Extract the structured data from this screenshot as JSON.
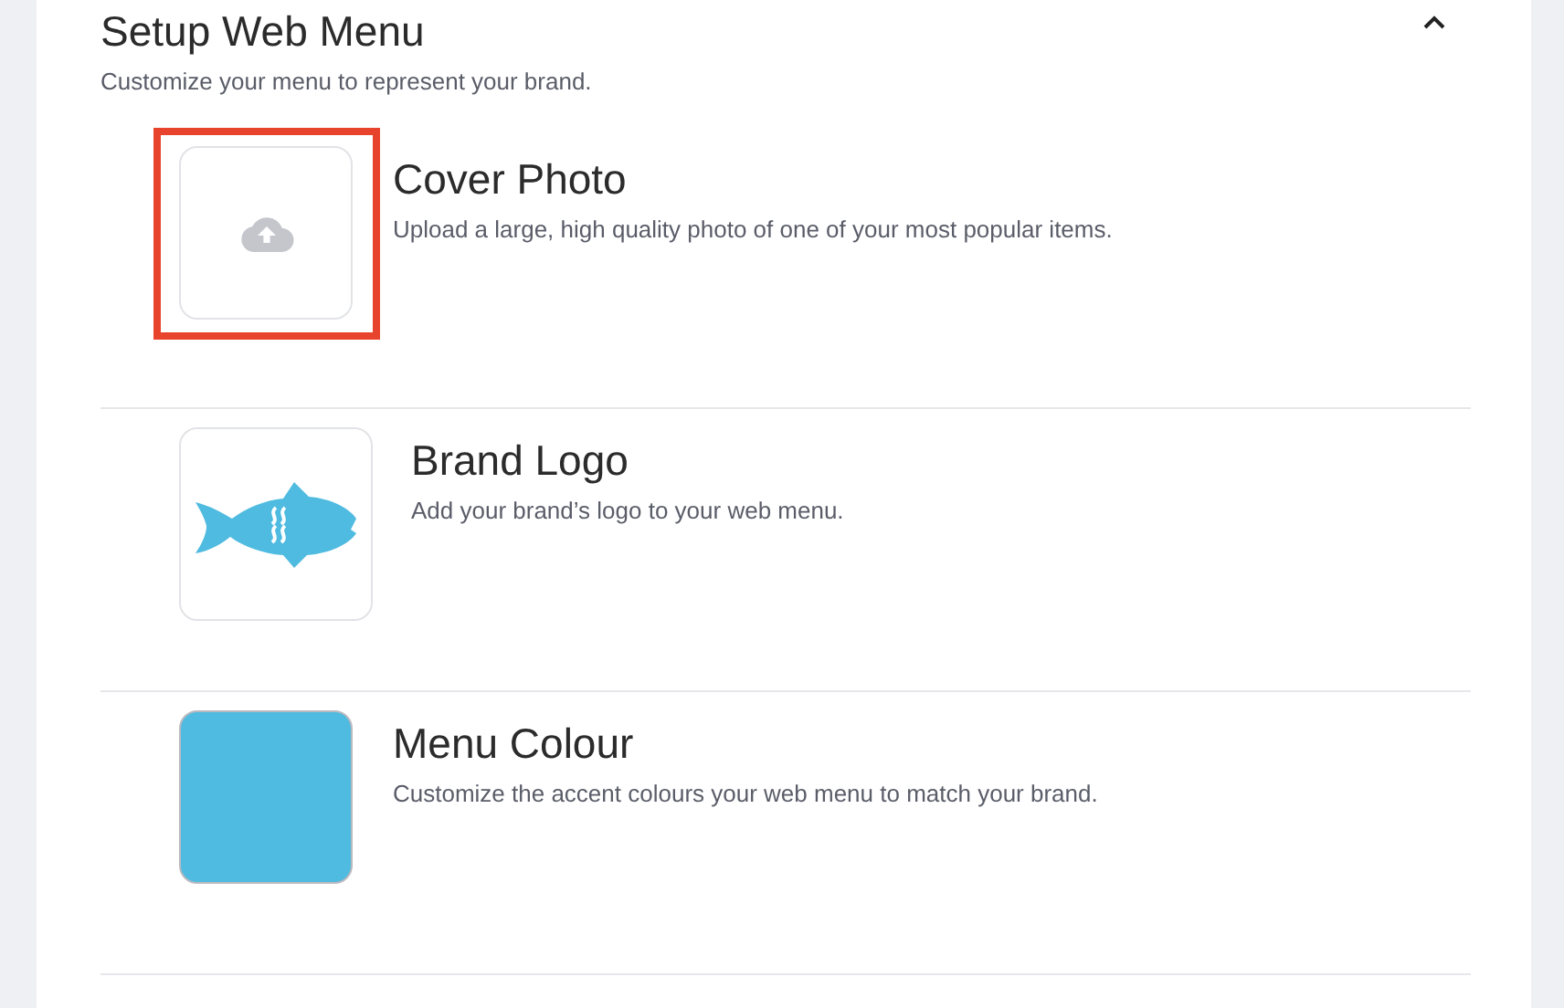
{
  "section": {
    "title": "Setup Web Menu",
    "subtitle": "Customize your menu to represent your brand.",
    "expanded": true
  },
  "items": [
    {
      "kind": "upload",
      "title": "Cover Photo",
      "description": "Upload a large, high quality photo of one of your most popular items.",
      "highlighted": true
    },
    {
      "kind": "logo",
      "title": "Brand Logo",
      "description": "Add your brand’s logo to your web menu.",
      "highlighted": false
    },
    {
      "kind": "color",
      "title": "Menu Colour",
      "description": "Customize the accent colours your web menu to match your brand.",
      "highlighted": false,
      "color": "#4fbbe0"
    }
  ]
}
